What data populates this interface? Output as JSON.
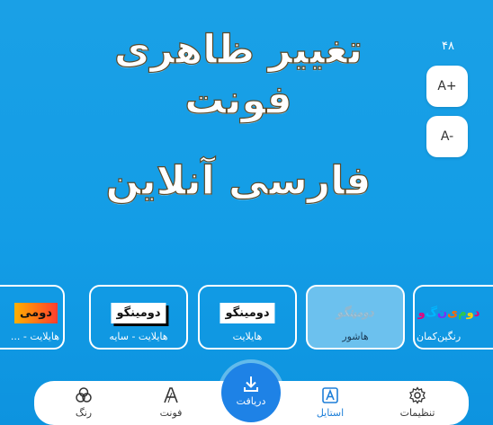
{
  "preview": {
    "line1": "تغییر ظاهری فونت",
    "line2": "فارسی آنلاین"
  },
  "size_controls": {
    "value": "۴۸",
    "increase_label": "A+",
    "decrease_label": "A-"
  },
  "style_cards": [
    {
      "label": "هایلایت - ...",
      "sample": "دومی"
    },
    {
      "label": "هایلایت - سایه",
      "sample": "دومینگو"
    },
    {
      "label": "هایلایت",
      "sample": "دومینگو"
    },
    {
      "label": "هاشور",
      "sample": "دومینگو",
      "selected": true
    },
    {
      "label": "رنگین‌کمان",
      "sample": "دومینگو"
    }
  ],
  "nav": {
    "color": "رنگ",
    "font": "فونت",
    "download": "دریافت",
    "style": "استایل",
    "settings": "تنظیمات"
  },
  "colors": {
    "background": "#139de6",
    "accent": "#1e82e6",
    "active_nav": "#1e7fd8"
  }
}
